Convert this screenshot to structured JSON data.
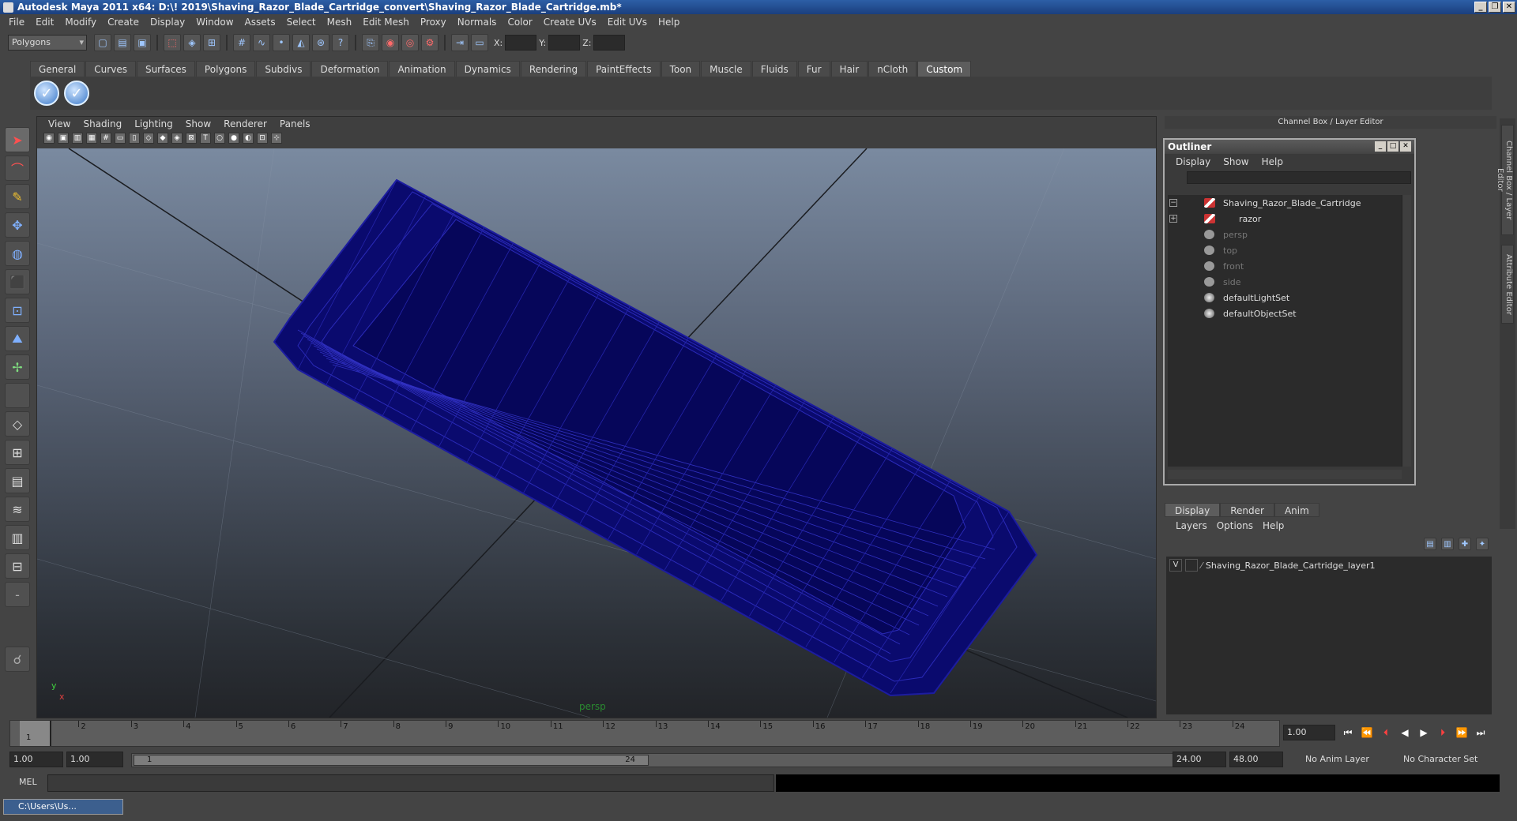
{
  "window": {
    "title": "Autodesk Maya 2011 x64: D:\\! 2019\\Shaving_Razor_Blade_Cartridge_convert\\Shaving_Razor_Blade_Cartridge.mb*"
  },
  "menubar": [
    "File",
    "Edit",
    "Modify",
    "Create",
    "Display",
    "Window",
    "Assets",
    "Select",
    "Mesh",
    "Edit Mesh",
    "Proxy",
    "Normals",
    "Color",
    "Create UVs",
    "Edit UVs",
    "Help"
  ],
  "toolbar": {
    "mode": "Polygons",
    "x_label": "X:",
    "y_label": "Y:",
    "z_label": "Z:"
  },
  "shelf_tabs": [
    "General",
    "Curves",
    "Surfaces",
    "Polygons",
    "Subdivs",
    "Deformation",
    "Animation",
    "Dynamics",
    "Rendering",
    "PaintEffects",
    "Toon",
    "Muscle",
    "Fluids",
    "Fur",
    "Hair",
    "nCloth",
    "Custom"
  ],
  "active_shelf": "Custom",
  "viewport": {
    "menu": [
      "View",
      "Shading",
      "Lighting",
      "Show",
      "Renderer",
      "Panels"
    ],
    "camera_label": "persp",
    "axis_y": "y",
    "axis_x": "x",
    "wire_color": "#0a0a8a"
  },
  "channel_box": {
    "title": "Channel Box / Layer Editor"
  },
  "outliner": {
    "title": "Outliner",
    "menu": [
      "Display",
      "Show",
      "Help"
    ],
    "items": [
      {
        "label": "Shaving_Razor_Blade_Cartridge",
        "icon": "mesh-icon",
        "expand": "−"
      },
      {
        "label": "razor",
        "icon": "mesh-icon",
        "expand": "+"
      },
      {
        "label": "persp",
        "icon": "camera-icon",
        "dim": true
      },
      {
        "label": "top",
        "icon": "camera-icon",
        "dim": true
      },
      {
        "label": "front",
        "icon": "camera-icon",
        "dim": true
      },
      {
        "label": "side",
        "icon": "camera-icon",
        "dim": true
      },
      {
        "label": "defaultLightSet",
        "icon": "set-icon"
      },
      {
        "label": "defaultObjectSet",
        "icon": "set-icon"
      }
    ]
  },
  "layer_editor": {
    "tabs": [
      "Display",
      "Render",
      "Anim"
    ],
    "menu": [
      "Layers",
      "Options",
      "Help"
    ],
    "layers": [
      {
        "visible": "V",
        "name": "Shaving_Razor_Blade_Cartridge_layer1"
      }
    ]
  },
  "right_tabs": [
    "Channel Box / Layer Editor",
    "Attribute Editor"
  ],
  "timeline": {
    "ticks": [
      "1",
      "2",
      "3",
      "4",
      "5",
      "6",
      "7",
      "8",
      "9",
      "10",
      "11",
      "12",
      "13",
      "14",
      "15",
      "16",
      "17",
      "18",
      "19",
      "20",
      "21",
      "22",
      "23",
      "24"
    ],
    "current_frame": "1.00",
    "current_marker": "1"
  },
  "range": {
    "start": "1.00",
    "playback_start": "1.00",
    "handle_start": "1",
    "handle_end": "24",
    "playback_end": "24.00",
    "end": "48.00",
    "anim_layer": "No Anim Layer",
    "character_set": "No Character Set"
  },
  "command": {
    "label": "MEL"
  },
  "taskbar": {
    "label": "C:\\Users\\Us..."
  }
}
